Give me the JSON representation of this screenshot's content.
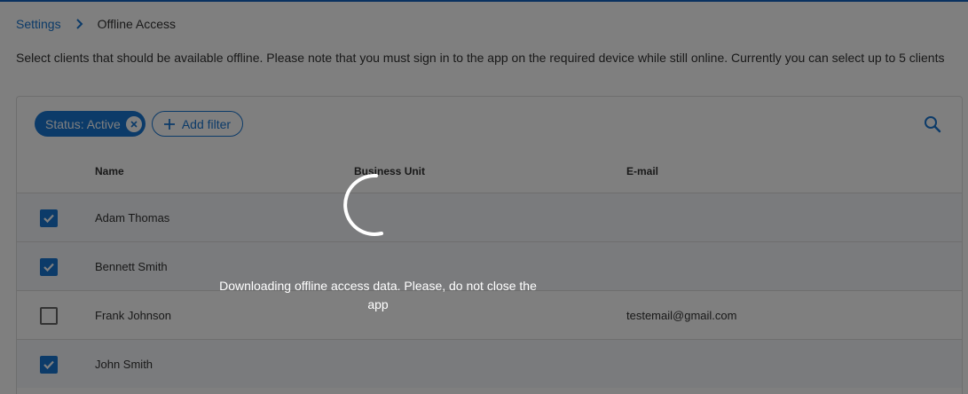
{
  "breadcrumb": {
    "parent": "Settings",
    "current": "Offline Access"
  },
  "description": "Select clients that should be available offline. Please note that you must sign in to the app on the required device while still online. Currently you can select up to 5 clients",
  "filters": {
    "active_chip": "Status: Active",
    "add_filter_label": "Add filter"
  },
  "table": {
    "columns": {
      "name": "Name",
      "business_unit": "Business Unit",
      "email": "E-mail"
    },
    "rows": [
      {
        "checked": true,
        "name": "Adam Thomas",
        "business_unit": "",
        "email": ""
      },
      {
        "checked": true,
        "name": "Bennett Smith",
        "business_unit": "",
        "email": ""
      },
      {
        "checked": false,
        "name": "Frank Johnson",
        "business_unit": "",
        "email": "testemail@gmail.com"
      },
      {
        "checked": true,
        "name": "John Smith",
        "business_unit": "",
        "email": ""
      }
    ]
  },
  "loading": {
    "message": "Downloading offline access data. Please, do not close the app"
  },
  "icons": {
    "breadcrumb_separator": "chevron-right-icon",
    "chip_remove": "close-icon",
    "add_filter": "plus-icon",
    "search": "search-icon",
    "checkbox_checked": "checkmark-icon",
    "spinner": "loading-spinner-icon"
  },
  "colors": {
    "accent": "#1976d2",
    "overlay": "rgba(0,0,0,0.5)"
  }
}
